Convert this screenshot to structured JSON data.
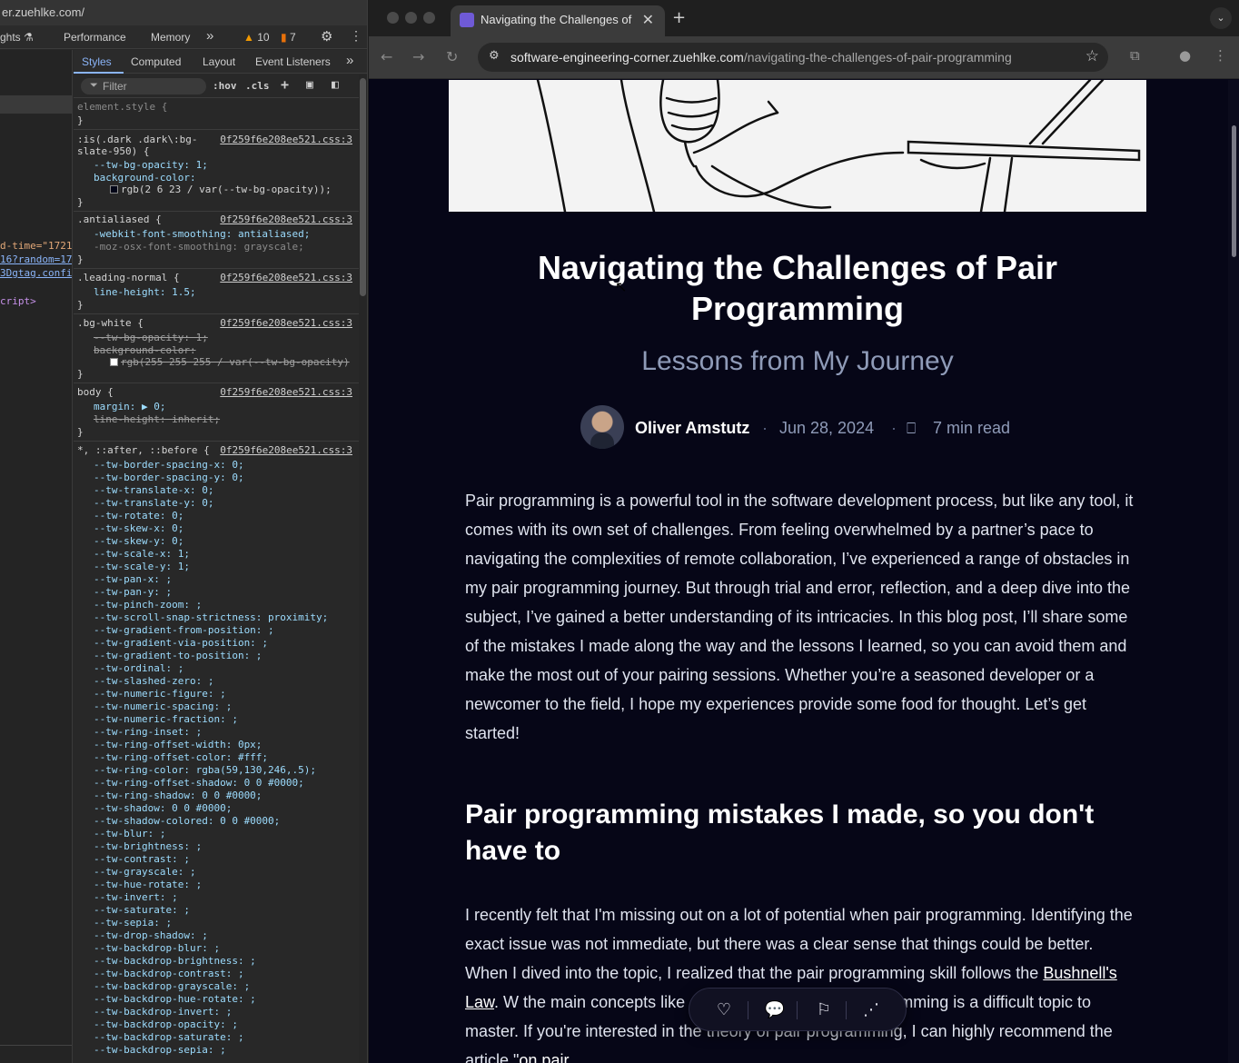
{
  "devtools": {
    "url_fragment": "er.zuehlke.com/",
    "topbar": {
      "insights_fragment": "ghts",
      "performance": "Performance",
      "memory": "Memory",
      "more": "»",
      "warnings": "10",
      "issues": "7"
    },
    "elements_fragments": [
      "d-time=\"1721",
      "16?random=17",
      "3Dgtag.confi",
      "cript>"
    ],
    "tabs": [
      "Styles",
      "Computed",
      "Layout",
      "Event Listeners",
      "»"
    ],
    "filter_placeholder": "Filter",
    "hov": ":hov",
    "cls": ".cls",
    "rules": [
      {
        "selector": "element.style {",
        "source": ""
      },
      {
        "selector": ":is(.dark .dark\\:bg-",
        "selector2": "slate-950) {",
        "source": "0f259f6e208ee521.css:3"
      },
      {
        "selector": ".antialiased {",
        "source": "0f259f6e208ee521.css:3"
      },
      {
        "selector": ".leading-normal {",
        "source": "0f259f6e208ee521.css:3"
      },
      {
        "selector": ".bg-white {",
        "source": "0f259f6e208ee521.css:3"
      },
      {
        "selector": "body {",
        "source": "0f259f6e208ee521.css:3"
      },
      {
        "selector": "*, ::after, ::before {",
        "source": "0f259f6e208ee521.css:3"
      }
    ],
    "decls": {
      "slate_opacity": "--tw-bg-opacity: 1;",
      "slate_bg": "background-color:",
      "slate_bg_val": "rgb(2 6 23 / var(--tw-bg-opacity));",
      "aa_webkit": "-webkit-font-smoothing: antialiased;",
      "aa_moz": "-moz-osx-font-smoothing: grayscale;",
      "ln_height": "line-height: 1.5;",
      "bw_opacity": "--tw-bg-opacity: 1;",
      "bw_bg": "background-color:",
      "bw_bg_val": "rgb(255 255 255 / var(--tw-bg-opacity)",
      "body_margin": "margin: ▶ 0;",
      "body_lh": "line-height: inherit;",
      "close": "}"
    },
    "vars": [
      "--tw-border-spacing-x: 0;",
      "--tw-border-spacing-y: 0;",
      "--tw-translate-x: 0;",
      "--tw-translate-y: 0;",
      "--tw-rotate: 0;",
      "--tw-skew-x: 0;",
      "--tw-skew-y: 0;",
      "--tw-scale-x: 1;",
      "--tw-scale-y: 1;",
      "--tw-pan-x: ;",
      "--tw-pan-y: ;",
      "--tw-pinch-zoom: ;",
      "--tw-scroll-snap-strictness: proximity;",
      "--tw-gradient-from-position: ;",
      "--tw-gradient-via-position: ;",
      "--tw-gradient-to-position: ;",
      "--tw-ordinal: ;",
      "--tw-slashed-zero: ;",
      "--tw-numeric-figure: ;",
      "--tw-numeric-spacing: ;",
      "--tw-numeric-fraction: ;",
      "--tw-ring-inset: ;",
      "--tw-ring-offset-width: 0px;",
      "--tw-ring-offset-color: #fff;",
      "--tw-ring-color: rgba(59,130,246,.5);",
      "--tw-ring-offset-shadow: 0 0 #0000;",
      "--tw-ring-shadow: 0 0 #0000;",
      "--tw-shadow: 0 0 #0000;",
      "--tw-shadow-colored: 0 0 #0000;",
      "--tw-blur: ;",
      "--tw-brightness: ;",
      "--tw-contrast: ;",
      "--tw-grayscale: ;",
      "--tw-hue-rotate: ;",
      "--tw-invert: ;",
      "--tw-saturate: ;",
      "--tw-sepia: ;",
      "--tw-drop-shadow: ;",
      "--tw-backdrop-blur: ;",
      "--tw-backdrop-brightness: ;",
      "--tw-backdrop-contrast: ;",
      "--tw-backdrop-grayscale: ;",
      "--tw-backdrop-hue-rotate: ;",
      "--tw-backdrop-invert: ;",
      "--tw-backdrop-opacity: ;",
      "--tw-backdrop-saturate: ;",
      "--tw-backdrop-sepia: ;"
    ]
  },
  "browser": {
    "tab_title": "Navigating the Challenges of",
    "tab_close": "✕",
    "new_tab": "+",
    "url_domain": "software-engineering-corner.zuehlke.com",
    "url_path": "/navigating-the-challenges-of-pair-programming"
  },
  "article": {
    "title": "Navigating the Challenges of Pair Programming",
    "subtitle": "Lessons from My Journey",
    "author": "Oliver Amstutz",
    "date": "Jun 28, 2024",
    "read_time": "7 min read",
    "intro": "Pair programming is a powerful tool in the software development process, but like any tool, it comes with its own set of challenges. From feeling overwhelmed by a partner’s pace to navigating the complexities of remote collaboration, I’ve experienced a range of obstacles in my pair programming journey. But through trial and error, reflection, and a deep dive into the subject, I’ve gained a better understanding of its intricacies. In this blog post, I’ll share some of the mistakes I made along the way and the lessons I learned, so you can avoid them and make the most out of your pairing sessions. Whether you’re a seasoned developer or a newcomer to the field, I hope my experiences provide some food for thought. Let’s get started!",
    "section_heading": "Pair programming mistakes I made, so you don't have to",
    "p2_before_link": "I recently felt that I'm missing out on a lot of potential when pair programming. Identifying the exact issue was not immediate, but there was a clear sense that things could be better. When I dived into the topic, I realized that the pair programming skill follows the ",
    "p2_link": "Bushnell's Law",
    "p2_after_link": ". W                             the main concepts like driver - navigator, pair programming is a difficult topic to master. If you're interested in the theory of pair programming, I can highly recommend the article \"",
    "p2_link2": "on pair"
  },
  "colors": {
    "page_bg": "#060617",
    "heading": "#ffffff",
    "body_text": "#dfe3ee",
    "muted": "#8f9bb8",
    "devtools_accent": "#8ab4f8"
  }
}
